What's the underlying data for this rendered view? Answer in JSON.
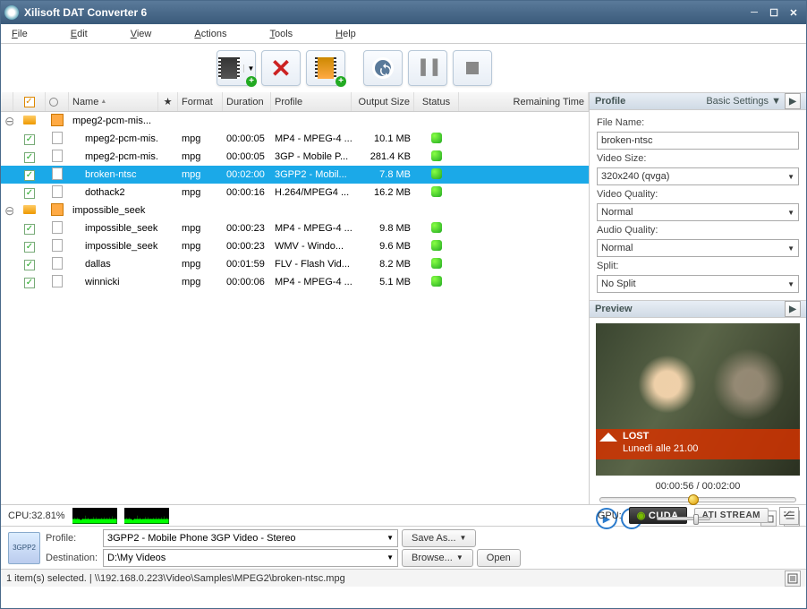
{
  "title": "Xilisoft DAT Converter 6",
  "menu": {
    "file": "File",
    "edit": "Edit",
    "view": "View",
    "actions": "Actions",
    "tools": "Tools",
    "help": "Help"
  },
  "columns": {
    "name": "Name",
    "format": "Format",
    "duration": "Duration",
    "profile": "Profile",
    "output": "Output Size",
    "status": "Status",
    "remaining": "Remaining Time"
  },
  "rows": [
    {
      "level": 0,
      "type": "group",
      "expanded": true,
      "check": "on",
      "name": "mpeg2-pcm-mis...",
      "format": "",
      "duration": "",
      "profile": "",
      "output": "",
      "status": "",
      "sel": false
    },
    {
      "level": 1,
      "type": "item",
      "check": "on",
      "name": "mpeg2-pcm-mis...",
      "format": "mpg",
      "duration": "00:00:05",
      "profile": "MP4 - MPEG-4 ...",
      "output": "10.1 MB",
      "status": "on",
      "sel": false
    },
    {
      "level": 1,
      "type": "item",
      "check": "on",
      "name": "mpeg2-pcm-mis...",
      "format": "mpg",
      "duration": "00:00:05",
      "profile": "3GP - Mobile P...",
      "output": "281.4 KB",
      "status": "on",
      "sel": false
    },
    {
      "level": 1,
      "type": "item",
      "check": "on",
      "name": "broken-ntsc",
      "format": "mpg",
      "duration": "00:02:00",
      "profile": "3GPP2 - Mobil...",
      "output": "7.8 MB",
      "status": "on",
      "sel": true
    },
    {
      "level": 1,
      "type": "item",
      "check": "on",
      "name": "dothack2",
      "format": "mpg",
      "duration": "00:00:16",
      "profile": "H.264/MPEG4 ...",
      "output": "16.2 MB",
      "status": "on",
      "sel": false
    },
    {
      "level": 0,
      "type": "group",
      "expanded": true,
      "check": "on",
      "name": "impossible_seek",
      "format": "",
      "duration": "",
      "profile": "",
      "output": "",
      "status": "",
      "sel": false
    },
    {
      "level": 1,
      "type": "item",
      "check": "on",
      "name": "impossible_seek...",
      "format": "mpg",
      "duration": "00:00:23",
      "profile": "MP4 - MPEG-4 ...",
      "output": "9.8 MB",
      "status": "on",
      "sel": false
    },
    {
      "level": 1,
      "type": "item",
      "check": "on",
      "name": "impossible_seek...",
      "format": "mpg",
      "duration": "00:00:23",
      "profile": "WMV - Windo...",
      "output": "9.6 MB",
      "status": "on",
      "sel": false
    },
    {
      "level": 1,
      "type": "item",
      "check": "on",
      "name": "dallas",
      "format": "mpg",
      "duration": "00:01:59",
      "profile": "FLV - Flash Vid...",
      "output": "8.2 MB",
      "status": "on",
      "sel": false
    },
    {
      "level": 1,
      "type": "item",
      "check": "on",
      "name": "winnicki",
      "format": "mpg",
      "duration": "00:00:06",
      "profile": "MP4 - MPEG-4 ...",
      "output": "5.1 MB",
      "status": "on",
      "sel": false
    }
  ],
  "profile_panel": {
    "title": "Profile",
    "settings_link": "Basic Settings",
    "filename_label": "File Name:",
    "filename": "broken-ntsc",
    "videosize_label": "Video Size:",
    "videosize": "320x240 (qvga)",
    "videoquality_label": "Video Quality:",
    "videoquality": "Normal",
    "audioquality_label": "Audio Quality:",
    "audioquality": "Normal",
    "split_label": "Split:",
    "split": "No Split"
  },
  "preview_panel": {
    "title": "Preview",
    "banner_title": "LOST",
    "banner_sub": "Lunedì alle 21.00",
    "time": "00:00:56 / 00:02:00",
    "slider_pct": 47
  },
  "cpu": {
    "label": "CPU:32.81%",
    "gpu_label": "GPU:",
    "cuda": "CUDA",
    "ati": "ATI STREAM"
  },
  "bottom": {
    "profile_lbl": "Profile:",
    "profile_val": "3GPP2 - Mobile Phone 3GP Video - Stereo",
    "saveas": "Save As...",
    "dest_lbl": "Destination:",
    "dest_val": "D:\\My Videos",
    "browse": "Browse...",
    "open": "Open",
    "fileicon": "3GPP2"
  },
  "status": "1 item(s) selected. | \\\\192.168.0.223\\Video\\Samples\\MPEG2\\broken-ntsc.mpg"
}
